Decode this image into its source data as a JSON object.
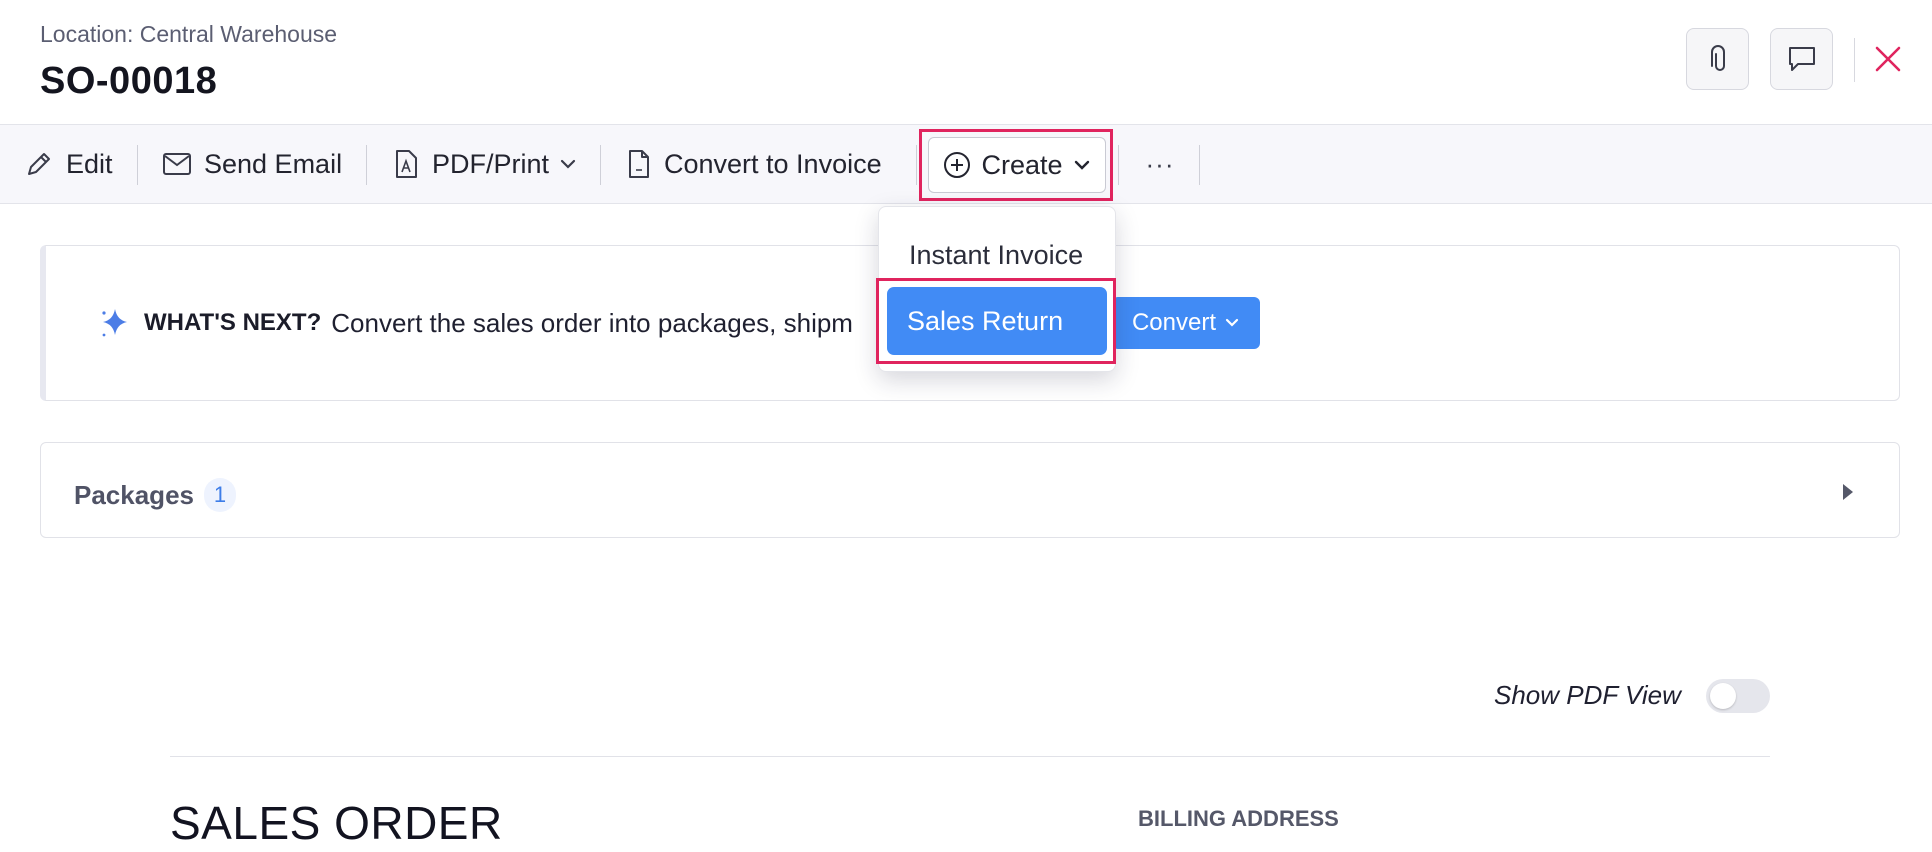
{
  "header": {
    "location": "Location: Central Warehouse",
    "title": "SO-00018",
    "icons": {
      "attach": "paperclip-icon",
      "comment": "comment-icon",
      "close": "close-icon"
    },
    "close_color": "#e0245e"
  },
  "toolbar": {
    "edit_label": "Edit",
    "send_email_label": "Send Email",
    "pdf_print_label": "PDF/Print",
    "convert_invoice_label": "Convert to Invoice",
    "create_label": "Create",
    "more_label": "···"
  },
  "create_menu": {
    "items": [
      {
        "label": "Instant Invoice",
        "selected": false
      },
      {
        "label": "Sales Return",
        "selected": true
      }
    ]
  },
  "whats_next": {
    "label": "WHAT'S NEXT?",
    "text": "Convert the sales order into packages, shipm",
    "button_label": "Convert"
  },
  "packages": {
    "label": "Packages",
    "count": "1"
  },
  "pdf_view": {
    "label": "Show PDF View",
    "enabled": false
  },
  "document": {
    "heading": "SALES ORDER",
    "billing_label": "BILLING ADDRESS"
  },
  "colors": {
    "accent": "#418bf5",
    "highlight": "#e0245e",
    "toolbar_bg": "#f7f7fb"
  }
}
